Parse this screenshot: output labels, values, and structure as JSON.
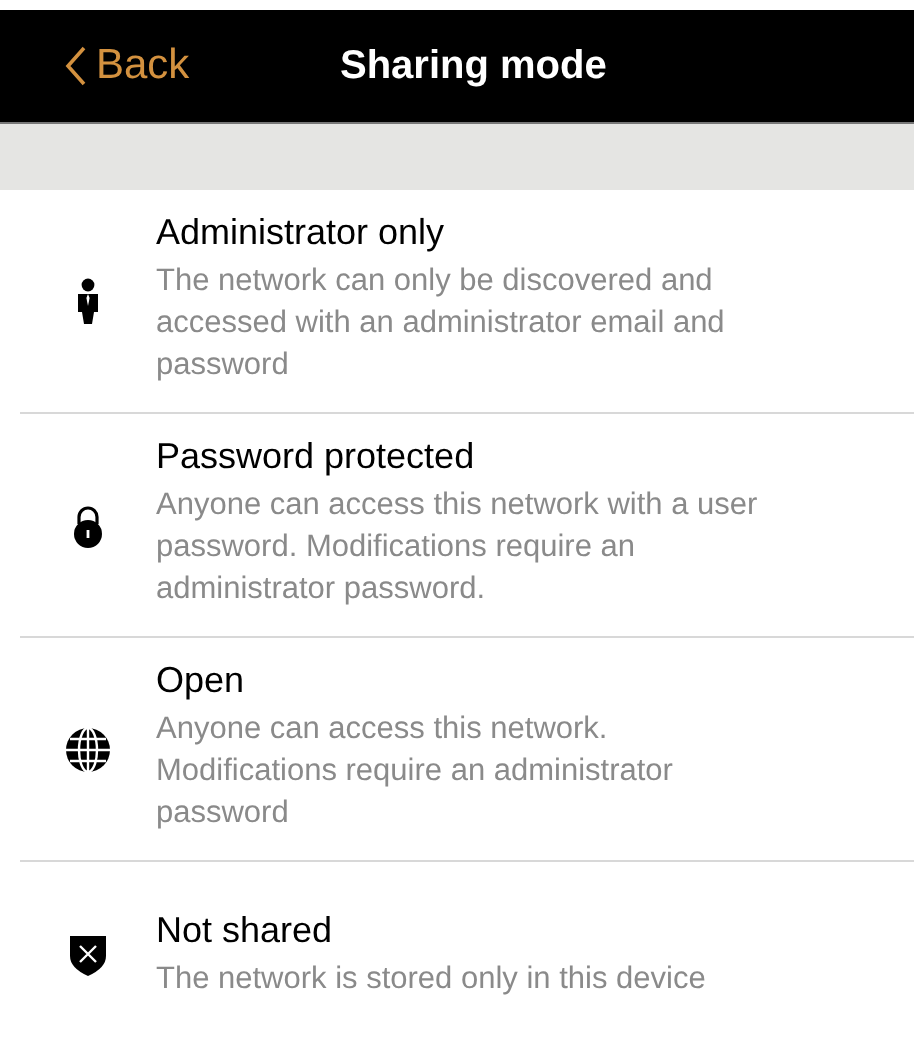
{
  "header": {
    "back": "Back",
    "title": "Sharing mode"
  },
  "options": [
    {
      "kind": "admin",
      "title": "Administrator only",
      "description": "The network can only be discovered and accessed with an administrator email and password"
    },
    {
      "kind": "password",
      "title": "Password protected",
      "description": "Anyone can access this network with a user password. Modifications require an administrator password."
    },
    {
      "kind": "open",
      "title": "Open",
      "description": "Anyone can access this network. Modifications require an administrator password"
    },
    {
      "kind": "private",
      "title": "Not shared",
      "description": "The network is stored only in this device"
    }
  ]
}
